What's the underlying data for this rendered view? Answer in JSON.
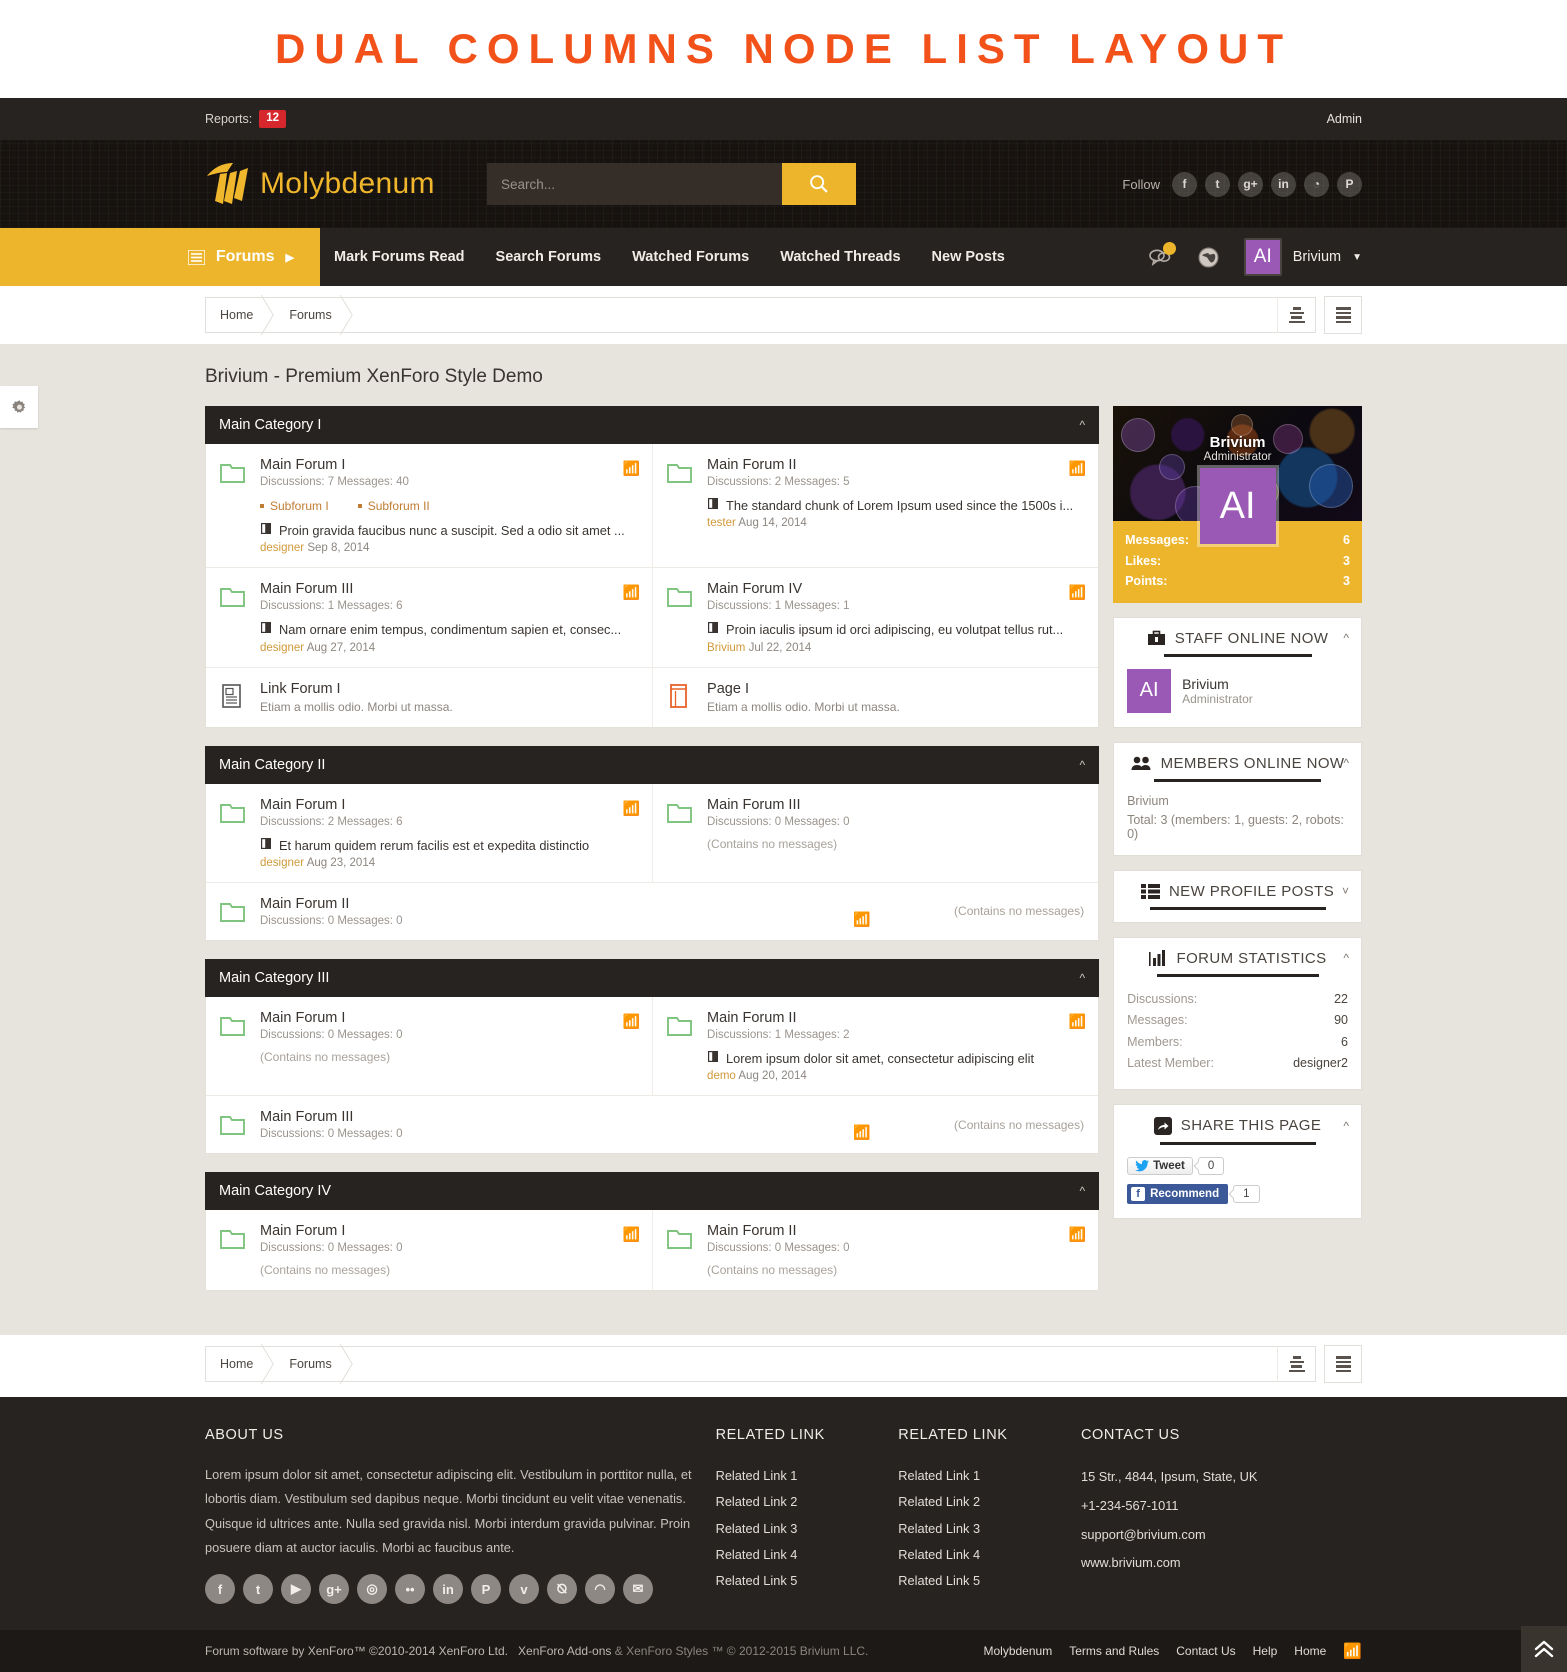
{
  "banner": {
    "text": "DUAL COLUMNS NODE LIST LAYOUT",
    "color": "#f3511a"
  },
  "topstrip": {
    "reports_label": "Reports:",
    "reports_count": "12",
    "admin_label": "Admin"
  },
  "header": {
    "logo_text": "Molybdenum",
    "search_placeholder": "Search...",
    "search_value": "",
    "follow_label": "Follow",
    "social": [
      {
        "name": "facebook-icon",
        "glyph": "f"
      },
      {
        "name": "twitter-icon",
        "glyph": "t"
      },
      {
        "name": "google-plus-icon",
        "glyph": "g+"
      },
      {
        "name": "linkedin-icon",
        "glyph": "in"
      },
      {
        "name": "dribbble-icon",
        "glyph": "◔"
      },
      {
        "name": "pinterest-icon",
        "glyph": "P"
      }
    ]
  },
  "nav": {
    "forums_label": "Forums",
    "links": [
      "Mark Forums Read",
      "Search Forums",
      "Watched Forums",
      "Watched Threads",
      "New Posts"
    ],
    "user_name": "Brivium",
    "user_initials": "AI"
  },
  "breadcrumb": {
    "items": [
      "Home",
      "Forums"
    ]
  },
  "page": {
    "title": "Brivium - Premium XenForo Style Demo"
  },
  "categories": [
    {
      "title": "Main Category I",
      "rows": [
        [
          {
            "type": "forum",
            "title": "Main Forum I",
            "stats": "Discussions: 7 Messages: 40",
            "subforums": [
              "Subforum I",
              "Subforum II"
            ],
            "last_post": "Proin gravida faucibus nunc a suscipit. Sed a odio sit amet ...",
            "last_user": "designer",
            "last_date": "Sep 8, 2014",
            "rss": true
          },
          {
            "type": "forum",
            "title": "Main Forum II",
            "stats": "Discussions: 2 Messages: 5",
            "last_post": "The standard chunk of Lorem Ipsum used since the 1500s i...",
            "last_user": "tester",
            "last_date": "Aug 14, 2014",
            "rss": true
          }
        ],
        [
          {
            "type": "forum",
            "title": "Main Forum III",
            "stats": "Discussions: 1 Messages: 6",
            "last_post": "Nam ornare enim tempus, condimentum sapien et, consec...",
            "last_user": "designer",
            "last_date": "Aug 27, 2014",
            "rss": true
          },
          {
            "type": "forum",
            "title": "Main Forum IV",
            "stats": "Discussions: 1 Messages: 1",
            "last_post": "Proin iaculis ipsum id orci adipiscing, eu volutpat tellus rut...",
            "last_user": "Brivium",
            "last_date": "Jul 22, 2014",
            "rss": true
          }
        ],
        [
          {
            "type": "link",
            "title": "Link Forum I",
            "desc": "Etiam a mollis odio. Morbi ut massa."
          },
          {
            "type": "page",
            "title": "Page I",
            "desc": "Etiam a mollis odio. Morbi ut massa."
          }
        ]
      ]
    },
    {
      "title": "Main Category II",
      "rows": [
        [
          {
            "type": "forum",
            "title": "Main Forum I",
            "stats": "Discussions: 2 Messages: 6",
            "last_post": "Et harum quidem rerum facilis est et expedita distinctio",
            "last_user": "designer",
            "last_date": "Aug 23, 2014",
            "rss": true
          },
          {
            "type": "forum",
            "title": "Main Forum III",
            "stats": "Discussions: 0 Messages: 0",
            "empty": "(Contains no messages)",
            "rss": false
          }
        ],
        [
          {
            "type": "forum",
            "title": "Main Forum II",
            "stats": "Discussions: 0 Messages: 0",
            "empty_right": "(Contains no messages)",
            "rss": true,
            "span": true
          }
        ]
      ]
    },
    {
      "title": "Main Category III",
      "rows": [
        [
          {
            "type": "forum",
            "title": "Main Forum I",
            "stats": "Discussions: 0 Messages: 0",
            "empty": "(Contains no messages)",
            "rss": true
          },
          {
            "type": "forum",
            "title": "Main Forum II",
            "stats": "Discussions: 1 Messages: 2",
            "last_post": "Lorem ipsum dolor sit amet, consectetur adipiscing elit",
            "last_user": "demo",
            "last_date": "Aug 20, 2014",
            "rss": true
          }
        ],
        [
          {
            "type": "forum",
            "title": "Main Forum III",
            "stats": "Discussions: 0 Messages: 0",
            "empty_right": "(Contains no messages)",
            "rss": true,
            "span": true
          }
        ]
      ]
    },
    {
      "title": "Main Category IV",
      "rows": [
        [
          {
            "type": "forum",
            "title": "Main Forum I",
            "stats": "Discussions: 0 Messages: 0",
            "empty": "(Contains no messages)",
            "rss": true
          },
          {
            "type": "forum",
            "title": "Main Forum II",
            "stats": "Discussions: 0 Messages: 0",
            "empty": "(Contains no messages)",
            "rss": true
          }
        ]
      ]
    }
  ],
  "sidebar": {
    "visitor": {
      "name": "Brivium",
      "title": "Administrator",
      "initials": "AI",
      "stats": [
        {
          "label": "Messages:",
          "value": "6"
        },
        {
          "label": "Likes:",
          "value": "3"
        },
        {
          "label": "Points:",
          "value": "3"
        }
      ]
    },
    "staff_online": {
      "title": "STAFF ONLINE NOW",
      "member": {
        "name": "Brivium",
        "title": "Administrator",
        "initials": "AI"
      }
    },
    "members_online": {
      "title": "MEMBERS ONLINE NOW",
      "names": "Brivium",
      "total": "Total: 3 (members: 1, guests: 2, robots: 0)"
    },
    "profile_posts": {
      "title": "NEW PROFILE POSTS"
    },
    "statistics": {
      "title": "FORUM STATISTICS",
      "rows": [
        {
          "label": "Discussions:",
          "value": "22"
        },
        {
          "label": "Messages:",
          "value": "90"
        },
        {
          "label": "Members:",
          "value": "6"
        },
        {
          "label": "Latest Member:",
          "value": "designer2"
        }
      ]
    },
    "share": {
      "title": "SHARE THIS PAGE",
      "tweet_label": "Tweet",
      "tweet_count": "0",
      "fb_label": "Recommend",
      "fb_count": "1"
    }
  },
  "footer": {
    "about_title": "ABOUT US",
    "about_text": "Lorem ipsum dolor sit amet, consectetur adipiscing elit. Vestibulum in porttitor nulla, et lobortis diam. Vestibulum sed dapibus neque. Morbi tincidunt eu velit vitae venenatis. Quisque id ultrices ante. Nulla sed gravida nisl. Morbi interdum gravida pulvinar. Proin posuere diam at auctor iaculis. Morbi ac faucibus ante.",
    "social": [
      {
        "name": "facebook-icon",
        "glyph": "f"
      },
      {
        "name": "twitter-icon",
        "glyph": "t"
      },
      {
        "name": "youtube-icon",
        "glyph": "▶"
      },
      {
        "name": "google-plus-icon",
        "glyph": "g+"
      },
      {
        "name": "dribbble-icon",
        "glyph": "◎"
      },
      {
        "name": "flickr-icon",
        "glyph": "••"
      },
      {
        "name": "linkedin-icon",
        "glyph": "in"
      },
      {
        "name": "pinterest-icon",
        "glyph": "P"
      },
      {
        "name": "vimeo-icon",
        "glyph": "v"
      },
      {
        "name": "deviantart-icon",
        "glyph": "⦰"
      },
      {
        "name": "rss-icon",
        "glyph": "◠"
      },
      {
        "name": "email-icon",
        "glyph": "✉"
      }
    ],
    "related1_title": "RELATED LINK",
    "related1": [
      "Related Link 1",
      "Related Link 2",
      "Related Link 3",
      "Related Link 4",
      "Related Link 5"
    ],
    "related2_title": "RELATED LINK",
    "related2": [
      "Related Link 1",
      "Related Link 2",
      "Related Link 3",
      "Related Link 4",
      "Related Link 5"
    ],
    "contact_title": "CONTACT US",
    "contact": [
      "15 Str., 4844, Ipsum, State, UK",
      "+1-234-567-1011",
      "support@brivium.com",
      "www.brivium.com"
    ]
  },
  "copyright": {
    "part1": "Forum software by XenForo™ ©2010-2014 XenForo Ltd.",
    "part2": "XenForo Add-ons",
    "part3": "& XenForo Styles ™ © 2012-2015 Brivium LLC.",
    "links": [
      "Molybdenum",
      "Terms and Rules",
      "Contact Us",
      "Help",
      "Home"
    ]
  }
}
